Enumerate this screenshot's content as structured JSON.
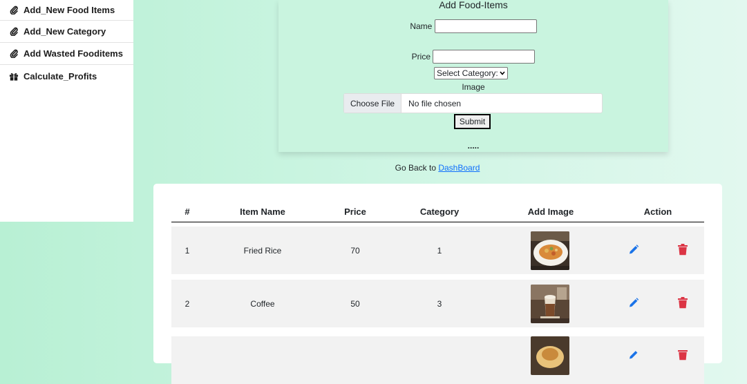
{
  "sidebar": {
    "items": [
      {
        "label": "Add_New Food Items",
        "icon": "paperclip-icon"
      },
      {
        "label": "Add_New Category",
        "icon": "paperclip-icon"
      },
      {
        "label": "Add Wasted Fooditems",
        "icon": "paperclip-icon"
      },
      {
        "label": "Calculate_Profits",
        "icon": "gift-icon"
      }
    ]
  },
  "form": {
    "title": "Add Food-Items",
    "name_label": "Name",
    "name_value": "",
    "price_label": "Price",
    "price_value": "",
    "category_select": "Select Category:",
    "image_label": "Image",
    "choose_file": "Choose File",
    "file_status": "No file chosen",
    "submit": "Submit",
    "dots": "....."
  },
  "goback": {
    "text": "Go Back to ",
    "link": "DashBoard"
  },
  "table": {
    "headers": [
      "#",
      "Item Name",
      "Price",
      "Category",
      "Add Image",
      "Action"
    ],
    "rows": [
      {
        "num": "1",
        "name": "Fried Rice",
        "price": "70",
        "category": "1"
      },
      {
        "num": "2",
        "name": "Coffee",
        "price": "50",
        "category": "3"
      }
    ]
  },
  "colors": {
    "edit": "#1a73e8",
    "delete": "#dc3545",
    "link": "#0d6efd"
  }
}
